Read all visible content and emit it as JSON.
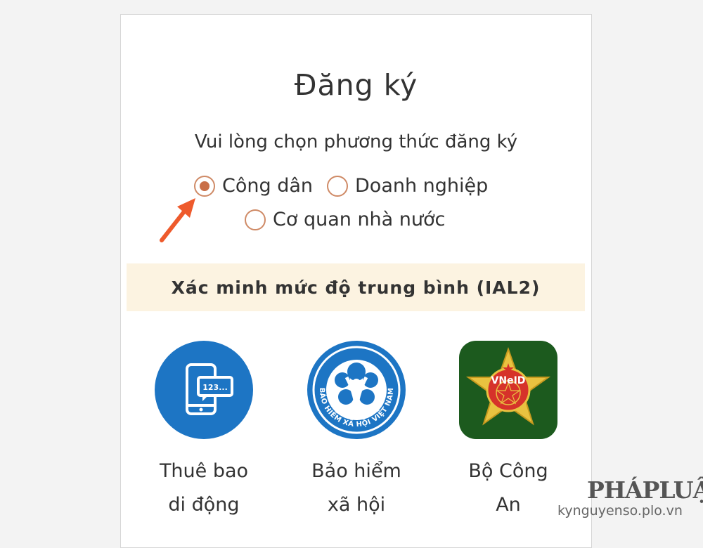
{
  "page": {
    "title": "Đăng ký",
    "subtitle": "Vui lòng chọn phương thức đăng ký"
  },
  "radio_options": [
    {
      "label": "Công dân",
      "selected": true
    },
    {
      "label": "Doanh nghiệp",
      "selected": false
    },
    {
      "label": "Cơ quan nhà nước",
      "selected": false
    }
  ],
  "banner": {
    "text": "Xác minh mức độ trung bình (IAL2)"
  },
  "methods": [
    {
      "line1": "Thuê bao",
      "line2": "di động",
      "icon": "phone-sms-icon",
      "logo_text": "123..."
    },
    {
      "line1": "Bảo hiểm",
      "line2": "xã hội",
      "icon": "bhxh-logo",
      "logo_text": "BẢO HIỂM XÃ HỘI VIỆT NAM"
    },
    {
      "line1": "Bộ Công",
      "line2": "An",
      "icon": "vneid-logo",
      "logo_text": "VNeID"
    }
  ],
  "watermark": {
    "brand": "PHÁPLUẬT",
    "url": "kynguyenso.plo.vn"
  },
  "colors": {
    "accent": "#c96f48",
    "radio_border": "#cf8a66",
    "banner_bg": "#fcf3e1",
    "blue": "#1d75c4",
    "vneid_green": "#1c5a1e",
    "arrow": "#ee5a2c"
  }
}
